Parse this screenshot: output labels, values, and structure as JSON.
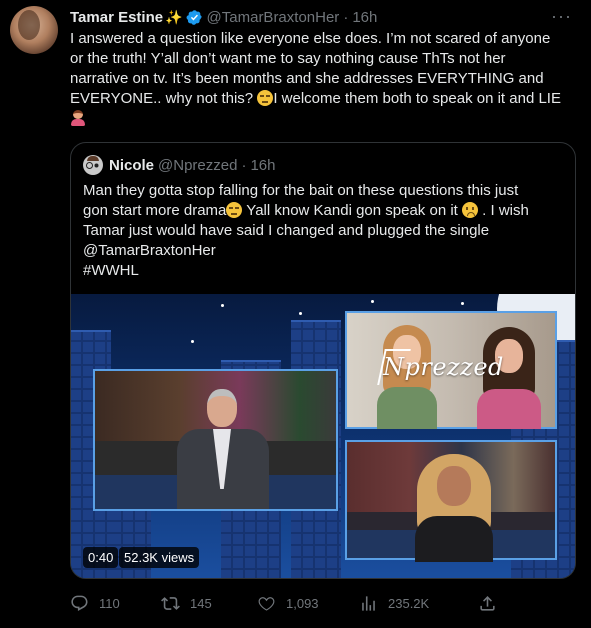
{
  "tweet": {
    "name": "Tamar Estine",
    "name_emoji": "✨",
    "handle": "@TamarBraxtonHer",
    "separator": "·",
    "time": "16h",
    "more_label": "···",
    "text_part1": "I answered a question like everyone else does. I’m not scared of anyone or the truth! Y’all don’t want me to say nothing cause ThTs not her narrative on tv. It’s been months and she addresses EVERYTHING and EVERYONE.. why not this? ",
    "text_part2": "I welcome them both to speak on it and LIE",
    "emoji_1": "unamused-face-icon",
    "emoji_2": "person-facepalming-icon"
  },
  "quote": {
    "name": "Nicole",
    "handle": "@Nprezzed",
    "separator": "·",
    "time": "16h",
    "line1_a": "Man they gotta stop falling for the bait on these questions this just",
    "line2_a": "gon start more drama",
    "line2_b": "  Yall know Kandi gon speak on it ",
    "line2_c": " . I wish",
    "line3": "Tamar just would have said I changed and  plugged the single",
    "line4": "@TamarBraxtonHer",
    "line5": "#WWHL",
    "video": {
      "watermark": "Nprezzed",
      "duration": "0:40",
      "views": "52.3K views"
    }
  },
  "actions": {
    "replies": "110",
    "retweets": "145",
    "likes": "1,093",
    "views": "235.2K"
  },
  "colors": {
    "background": "#000000",
    "text_primary": "#e7e9ea",
    "text_secondary": "#71767b",
    "verified_blue": "#1d9bf0",
    "border": "#2f3336"
  }
}
